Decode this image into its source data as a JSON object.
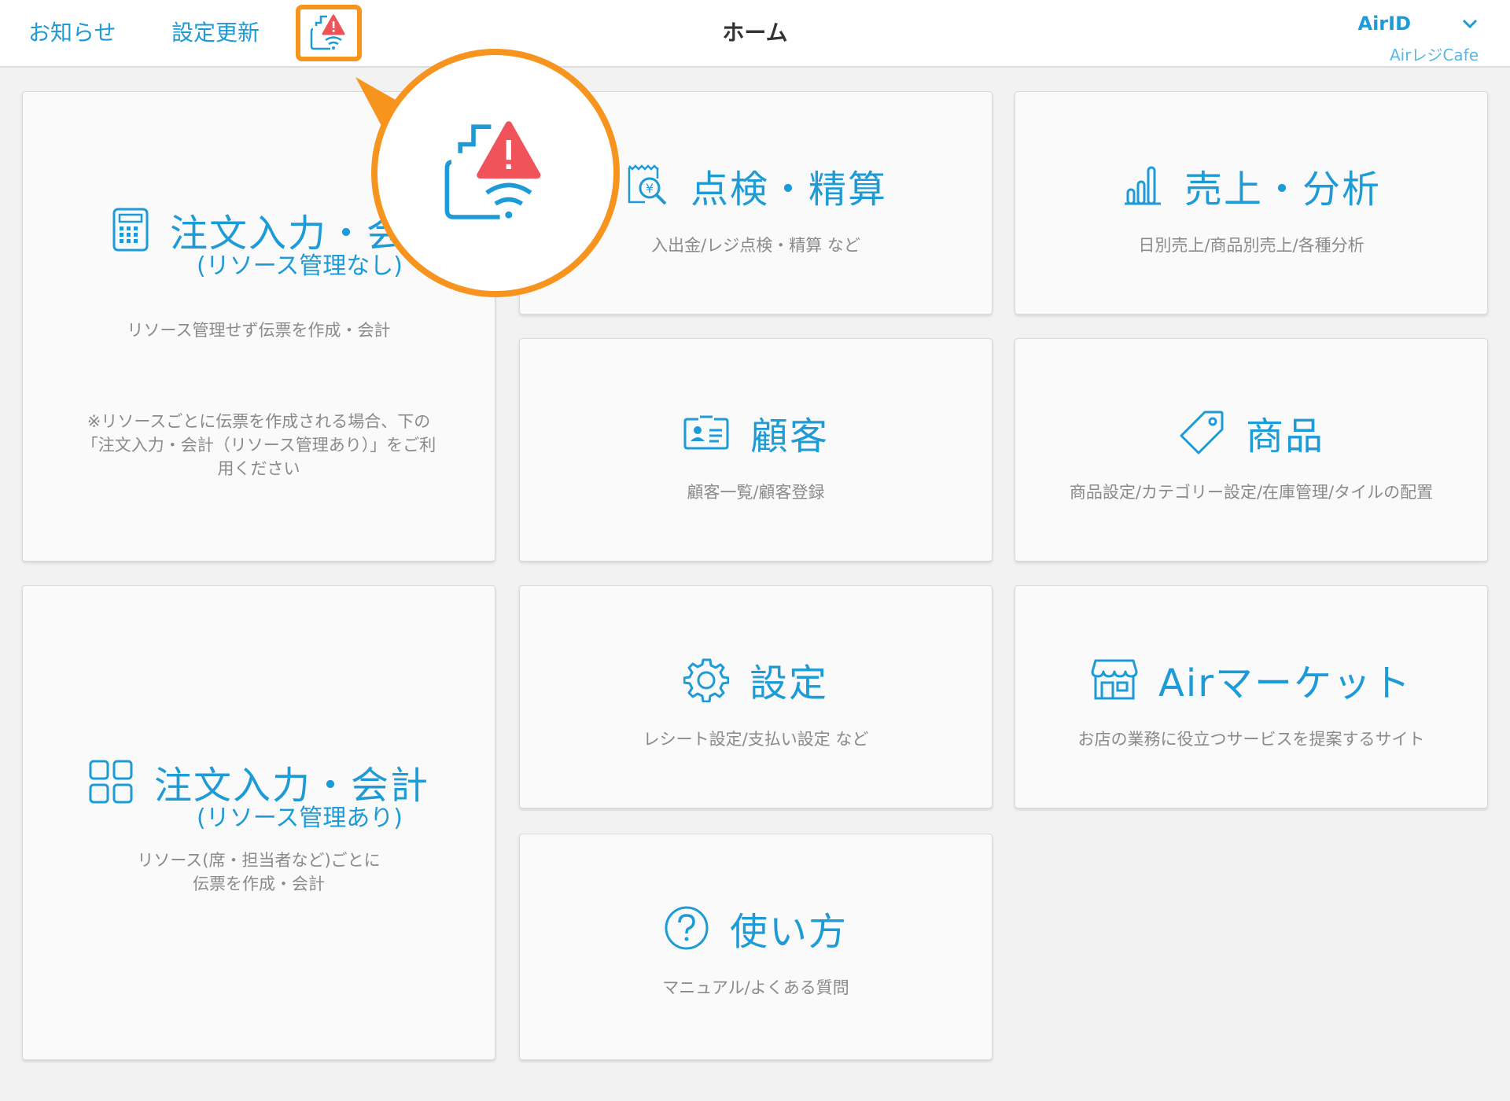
{
  "header": {
    "notice_label": "お知らせ",
    "update_label": "設定更新",
    "page_title": "ホーム",
    "account_name": "AirID",
    "store_name": "AirレジCafe"
  },
  "tiles": {
    "order_no_resource": {
      "title": "注文入力・会",
      "subtitle": "(リソース管理なし)",
      "desc": "リソース管理せず伝票を作成・会計",
      "note_lines": [
        "※リソースごとに伝票を作成される場合、下の",
        "「注文入力・会計（リソース管理あり）」をご利",
        "用ください"
      ]
    },
    "checkout": {
      "title": "点検・精算",
      "desc": "入出金/レジ点検・精算 など"
    },
    "sales": {
      "title": "売上・分析",
      "desc": "日別売上/商品別売上/各種分析"
    },
    "customer": {
      "title": "顧客",
      "desc": "顧客一覧/顧客登録"
    },
    "product": {
      "title": "商品",
      "desc": "商品設定/カテゴリー設定/在庫管理/タイルの配置"
    },
    "settings": {
      "title": "設定",
      "desc": "レシート設定/支払い設定 など"
    },
    "market": {
      "title": "Airマーケット",
      "desc": "お店の業務に役立つサービスを提案するサイト"
    },
    "order_resource": {
      "title": "注文入力・会計",
      "subtitle": "(リソース管理あり)",
      "desc_lines": [
        "リソース(席・担当者など)ごとに",
        "伝票を作成・会計"
      ]
    },
    "help": {
      "title": "使い方",
      "desc": "マニュアル/よくある質問"
    }
  },
  "colors": {
    "accent": "#1d9bd7",
    "highlight": "#f7941d",
    "warning": "#f0545a",
    "background": "#f2f2f2"
  },
  "icons": {
    "status": "printer-warning-icon",
    "chevron": "chevron-down-icon"
  }
}
